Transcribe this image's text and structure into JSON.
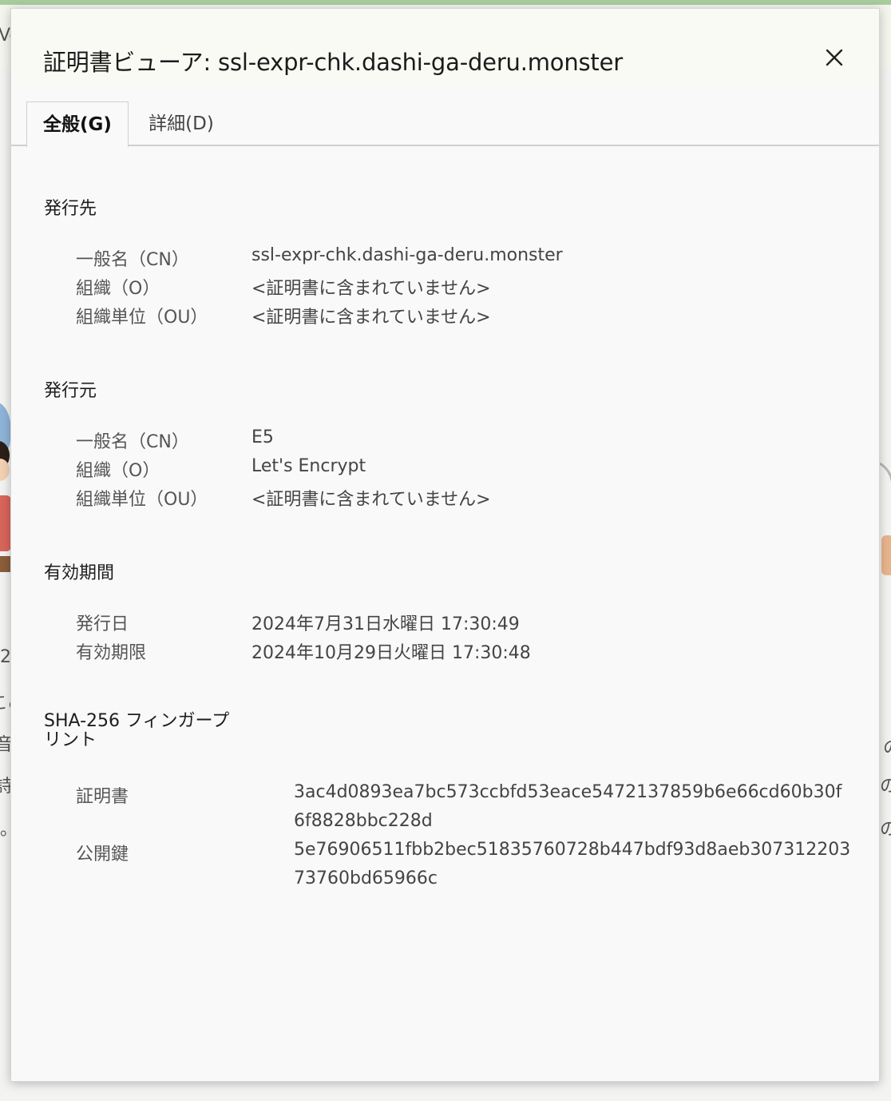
{
  "background": {
    "fragments": [
      "Ve",
      "2",
      "こめ",
      "音",
      "詩",
      "。",
      "の",
      "の",
      "の"
    ]
  },
  "dialog": {
    "title": "証明書ビューア: ssl-expr-chk.dashi-ga-deru.monster",
    "close_icon": "close-icon",
    "tabs": [
      {
        "label": "全般(G)",
        "active": true
      },
      {
        "label": "詳細(D)",
        "active": false
      }
    ]
  },
  "issued_to": {
    "title": "発行先",
    "rows": [
      {
        "label": "一般名（CN）",
        "value": "ssl-expr-chk.dashi-ga-deru.monster"
      },
      {
        "label": "組織（O）",
        "value": "<証明書に含まれていません>"
      },
      {
        "label": "組織単位（OU）",
        "value": "<証明書に含まれていません>"
      }
    ]
  },
  "issued_by": {
    "title": "発行元",
    "rows": [
      {
        "label": "一般名（CN）",
        "value": "E5"
      },
      {
        "label": "組織（O）",
        "value": "Let's Encrypt"
      },
      {
        "label": "組織単位（OU）",
        "value": "<証明書に含まれていません>"
      }
    ]
  },
  "validity": {
    "title": "有効期間",
    "rows": [
      {
        "label": "発行日",
        "value": "2024年7月31日水曜日 17:30:49"
      },
      {
        "label": "有効期限",
        "value": "2024年10月29日火曜日 17:30:48"
      }
    ]
  },
  "fingerprints": {
    "title_line1": "SHA-256 フィンガープ",
    "title_line2": "リント",
    "rows": [
      {
        "label": "証明書",
        "value": "3ac4d0893ea7bc573ccbfd53eace5472137859b6e66cd60b30f6f8828bbc228d"
      },
      {
        "label": "公開鍵",
        "value": "5e76906511fbb2bec51835760728b447bdf93d8aeb30731220373760bd65966c"
      }
    ]
  }
}
